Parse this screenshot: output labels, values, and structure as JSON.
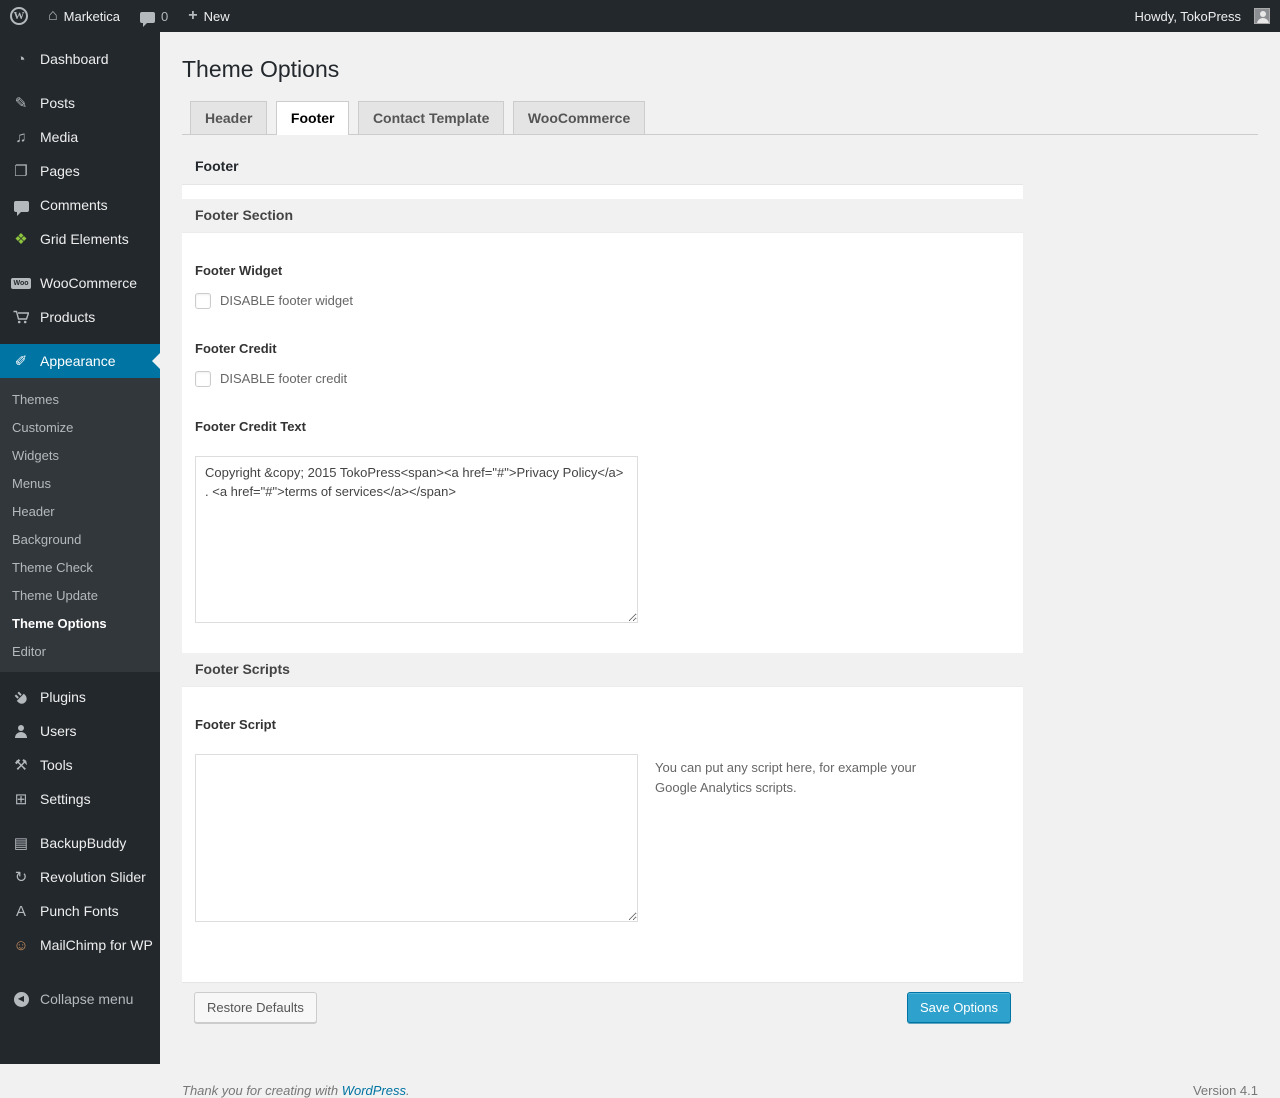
{
  "admin_bar": {
    "site_name": "Marketica",
    "comment_count": "0",
    "new_label": "New",
    "howdy": "Howdy, TokoPress"
  },
  "sidebar": {
    "items": [
      {
        "icon": "dashboard-icon",
        "label": "Dashboard"
      },
      {
        "icon": "posts-icon",
        "label": "Posts"
      },
      {
        "icon": "media-icon",
        "label": "Media"
      },
      {
        "icon": "pages-icon",
        "label": "Pages"
      },
      {
        "icon": "comments-icon",
        "label": "Comments"
      },
      {
        "icon": "grid-elements-icon",
        "label": "Grid Elements"
      },
      {
        "icon": "woocommerce-icon",
        "label": "WooCommerce"
      },
      {
        "icon": "products-icon",
        "label": "Products"
      },
      {
        "icon": "appearance-icon",
        "label": "Appearance"
      },
      {
        "icon": "plugins-icon",
        "label": "Plugins"
      },
      {
        "icon": "users-icon",
        "label": "Users"
      },
      {
        "icon": "tools-icon",
        "label": "Tools"
      },
      {
        "icon": "settings-icon",
        "label": "Settings"
      },
      {
        "icon": "backupbuddy-icon",
        "label": "BackupBuddy"
      },
      {
        "icon": "revolution-slider-icon",
        "label": "Revolution Slider"
      },
      {
        "icon": "punch-fonts-icon",
        "label": "Punch Fonts"
      },
      {
        "icon": "mailchimp-icon",
        "label": "MailChimp for WP"
      },
      {
        "icon": "collapse-icon",
        "label": "Collapse menu"
      }
    ],
    "appearance_submenu": [
      "Themes",
      "Customize",
      "Widgets",
      "Menus",
      "Header",
      "Background",
      "Theme Check",
      "Theme Update",
      "Theme Options",
      "Editor"
    ]
  },
  "page": {
    "title": "Theme Options",
    "tabs": [
      {
        "label": "Header",
        "active": false
      },
      {
        "label": "Footer",
        "active": true
      },
      {
        "label": "Contact Template",
        "active": false
      },
      {
        "label": "WooCommerce",
        "active": false
      }
    ]
  },
  "panel": {
    "box_title": "Footer",
    "section1_title": "Footer Section",
    "footer_widget_label": "Footer Widget",
    "footer_widget_checkbox_label": "DISABLE footer widget",
    "footer_credit_label": "Footer Credit",
    "footer_credit_checkbox_label": "DISABLE footer credit",
    "footer_credit_text_label": "Footer Credit Text",
    "footer_credit_text_value": "Copyright &copy; 2015 TokoPress<span><a href=\"#\">Privacy Policy</a> . <a href=\"#\">terms of services</a></span>",
    "section2_title": "Footer Scripts",
    "footer_script_label": "Footer Script",
    "footer_script_value": "",
    "footer_script_help": "You can put any script here, for example your Google Analytics scripts.",
    "restore_button": "Restore Defaults",
    "save_button": "Save Options"
  },
  "footer": {
    "thankyou_prefix": "Thank you for creating with ",
    "wordpress_link": "WordPress",
    "thankyou_suffix": ".",
    "version": "Version 4.1"
  },
  "colors": {
    "accent_blue": "#0074a2",
    "button_primary": "#2ea2cc",
    "admin_dark": "#23282d",
    "submenu_dark": "#32373c",
    "page_background": "#f1f1f1"
  }
}
